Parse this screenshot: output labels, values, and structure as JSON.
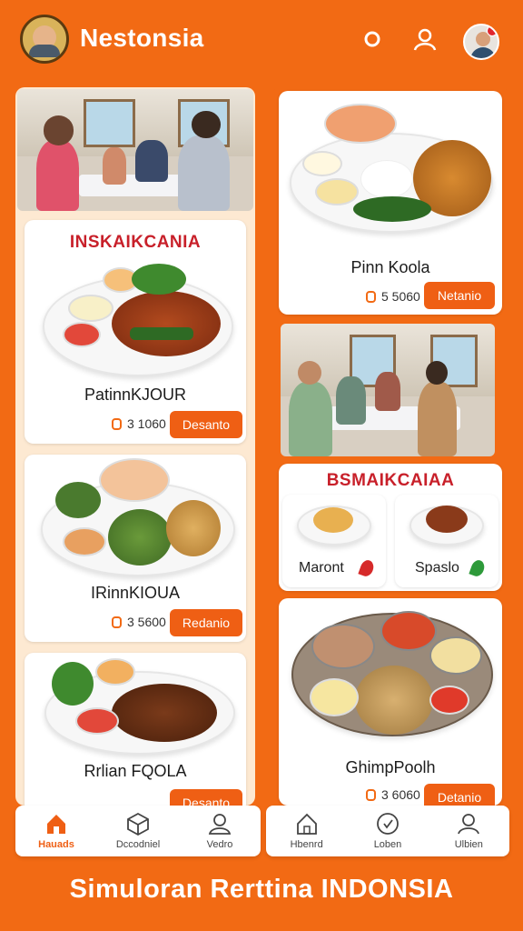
{
  "header": {
    "app_title": "Nestonsia",
    "icons": [
      "logo-badge",
      "search-icon",
      "user-icon",
      "avatar"
    ],
    "notification_badge": "!"
  },
  "left_column": {
    "cards": [
      {
        "heading": "INSKAIKCANIA",
        "dish": "PatinnKJOUR",
        "price": "3 1060",
        "button": "Desanto"
      },
      {
        "heading": "",
        "dish": "IRinnKIOUA",
        "price": "3 5600",
        "button": "Redanio"
      },
      {
        "heading": "",
        "dish": "Rrlian FQOLA",
        "price": "",
        "button": "Desanto"
      }
    ]
  },
  "right_column": {
    "top_card": {
      "dish": "Pinn Koola",
      "price": "5 5060",
      "button": "Netanio"
    },
    "promo_card": {
      "heading": "BSMAIKCAIAA",
      "items": [
        {
          "name": "Maront",
          "indicator": "red"
        },
        {
          "name": "Spaslo",
          "indicator": "green"
        }
      ]
    },
    "platter_card": {
      "dish": "GhimpPoolh",
      "price": "3 6060",
      "button": "Detanio"
    }
  },
  "bottom_nav_left": [
    {
      "label": "Hauads",
      "icon": "home-icon",
      "active": true
    },
    {
      "label": "Dccodniel",
      "icon": "box-icon",
      "active": false
    },
    {
      "label": "Vedro",
      "icon": "person-icon",
      "active": false
    }
  ],
  "bottom_nav_right": [
    {
      "label": "Hbenrd",
      "icon": "house-icon",
      "active": false
    },
    {
      "label": "Loben",
      "icon": "coin-icon",
      "active": false
    },
    {
      "label": "Ulbien",
      "icon": "profile-icon",
      "active": false
    }
  ],
  "footer": {
    "text": "Simuloran Rerttina INDONSIA"
  },
  "colors": {
    "brand_orange": "#f26a14",
    "button_orange": "#ef5f14",
    "heading_red": "#c8202a",
    "panel_cream": "#fde9d2"
  }
}
